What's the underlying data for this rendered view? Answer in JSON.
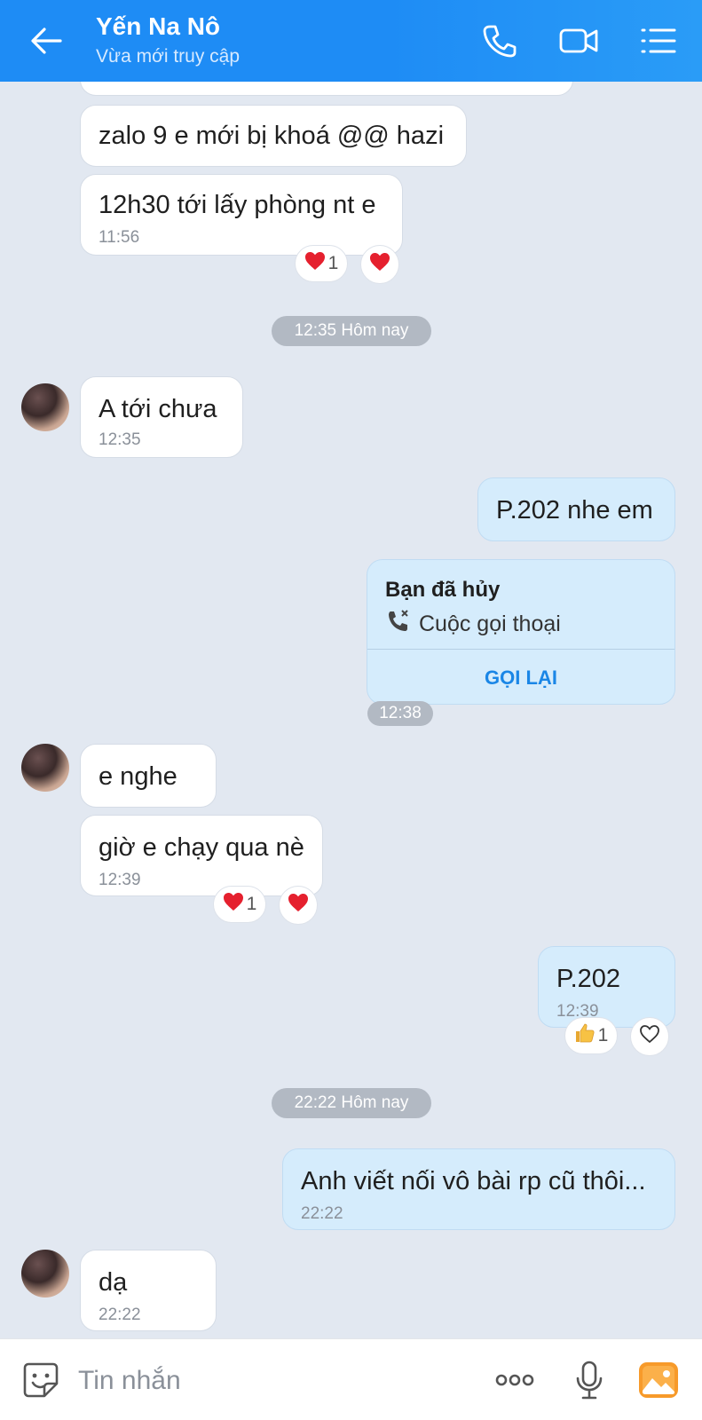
{
  "header": {
    "contact_name": "Yến Na Nô",
    "status": "Vừa mới truy cập"
  },
  "messages": {
    "m1": {
      "text": "zalo 9 e mới bị khoá @@ hazi"
    },
    "m2": {
      "text": "12h30 tới lấy phòng nt e",
      "time": "11:56",
      "reaction_count": "1"
    },
    "sep1": "12:35 Hôm nay",
    "m3": {
      "text": "A tới chưa",
      "time": "12:35"
    },
    "m4": {
      "text": "P.202 nhe em"
    },
    "call": {
      "title": "Bạn đã hủy",
      "subtitle": "Cuộc gọi thoại",
      "action": "GỌI LẠI",
      "time": "12:38"
    },
    "m5": {
      "text": "e nghe"
    },
    "m6": {
      "text": "giờ e chạy qua nè",
      "time": "12:39",
      "reaction_count": "1"
    },
    "m7": {
      "text": "P.202",
      "time": "12:39",
      "reaction_count": "1"
    },
    "sep2": "22:22 Hôm nay",
    "m8": {
      "text": "Anh viết nối vô bài rp cũ thôi...",
      "time": "22:22"
    },
    "m9": {
      "text": "dạ",
      "time": "22:22"
    }
  },
  "input": {
    "placeholder": "Tin nhắn"
  },
  "colors": {
    "header_blue": "#1e8cf5",
    "incoming_bubble": "#ffffff",
    "outgoing_bubble": "#d5ecfc",
    "chat_background": "#e2e8f1",
    "reaction_heart": "#e5202e",
    "call_action": "#1a86e6"
  },
  "icons": [
    "back-arrow-icon",
    "phone-icon",
    "video-call-icon",
    "menu-list-icon",
    "heart-icon",
    "thumbs-up-icon",
    "sticker-icon",
    "more-icon",
    "microphone-icon",
    "image-icon"
  ]
}
